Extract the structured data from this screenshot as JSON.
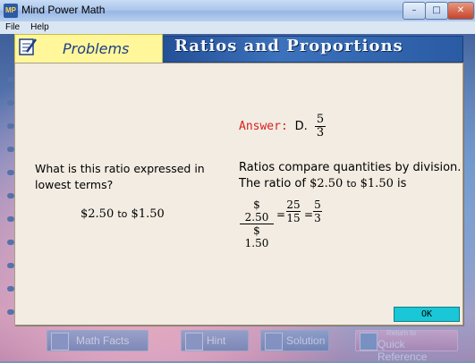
{
  "window": {
    "app_icon": "MP",
    "title": "Mind Power Math",
    "minimize_glyph": "–",
    "maximize_glyph": "□",
    "close_glyph": "✕"
  },
  "menu": {
    "file": "File",
    "help": "Help"
  },
  "header": {
    "tab_label": "Problems",
    "title": "Ratios and Proportions",
    "tab_icon": "notebook-pencil-icon"
  },
  "answer": {
    "label": "Answer:",
    "choice": "D.",
    "numerator": "5",
    "denominator": "3"
  },
  "question": {
    "text": "What is this ratio expressed in lowest terms?",
    "ratio_left": "$2.50",
    "ratio_to": "to",
    "ratio_right": "$1.50"
  },
  "explanation": {
    "line1": "Ratios compare quantities by division.",
    "line2_prefix": "The ratio of",
    "line2_a": "$2.50",
    "line2_to": "to",
    "line2_b": "$1.50",
    "line2_suffix": "is",
    "eq1_num": "$ 2.50",
    "eq1_den": "$ 1.50",
    "eq_sign": "=",
    "eq2_num": "25",
    "eq2_den": "15",
    "eq3_num": "5",
    "eq3_den": "3"
  },
  "ok_button": "OK",
  "toolbar": {
    "math_facts": "Math Facts",
    "hint": "Hint",
    "solution": "Solution",
    "quick_ref_top": "Return to",
    "quick_ref": "Quick Reference"
  },
  "colors": {
    "answer_label": "#d82020",
    "ok_button": "#19c7d6",
    "tab": "#fff79a",
    "header_bar": "#2a5ba4"
  }
}
